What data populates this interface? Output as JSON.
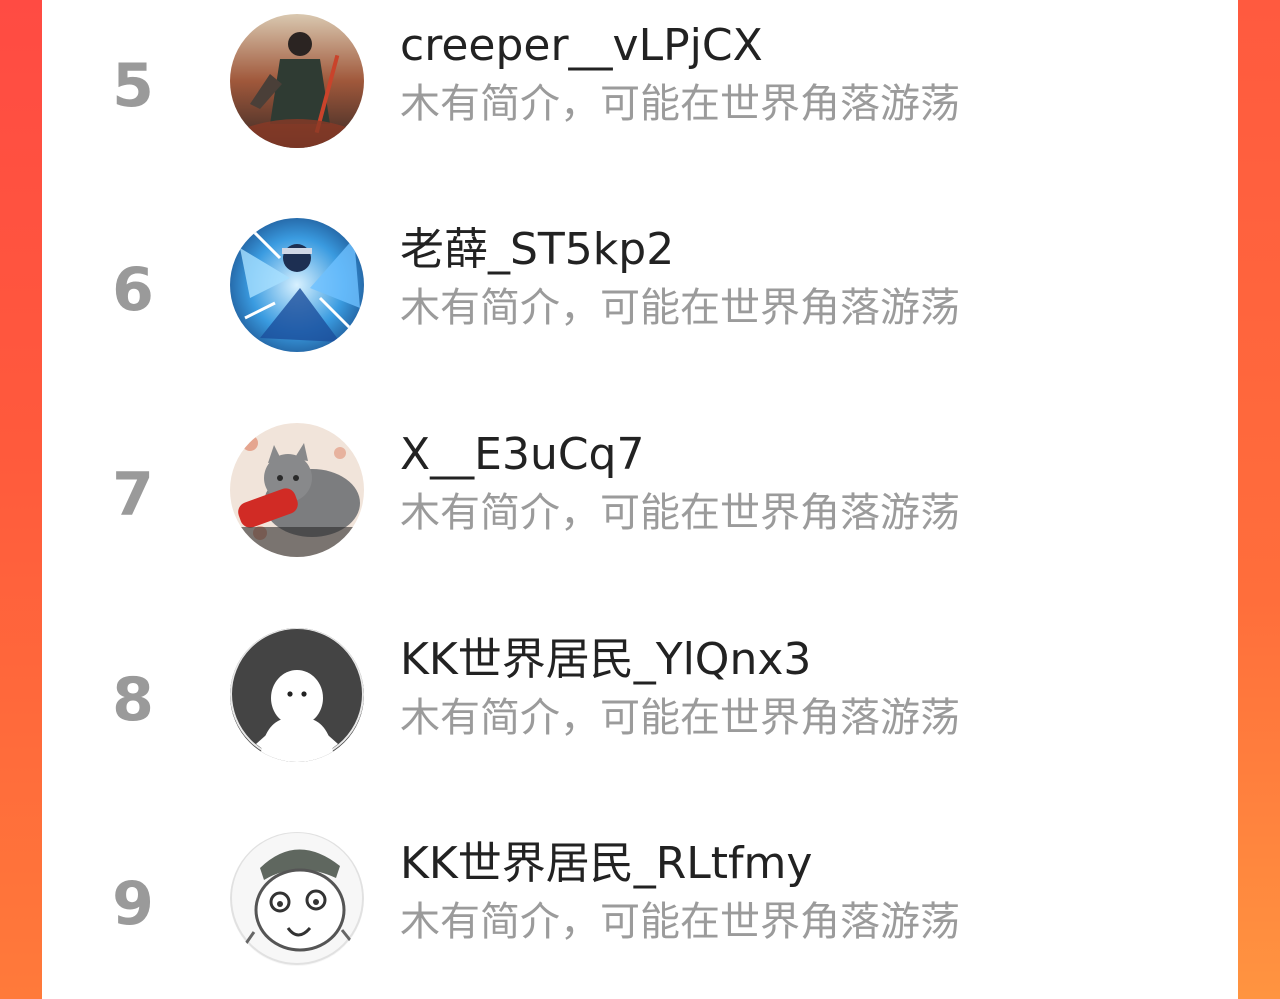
{
  "ranking": {
    "items": [
      {
        "rank": "5",
        "username": "creeper__vLPjCX",
        "bio": "木有简介，可能在世界角落游荡",
        "avatar": "warrior-avatar-icon"
      },
      {
        "rank": "6",
        "username": "老薛_ST5kp2",
        "bio": "木有简介，可能在世界角落游荡",
        "avatar": "ninja-avatar-icon"
      },
      {
        "rank": "7",
        "username": "X__E3uCq7",
        "bio": "木有简介，可能在世界角落游荡",
        "avatar": "cat-avatar-icon"
      },
      {
        "rank": "8",
        "username": "KK世界居民_YlQnx3",
        "bio": "木有简介，可能在世界角落游荡",
        "avatar": "default-avatar-icon"
      },
      {
        "rank": "9",
        "username": "KK世界居民_RLtfmy",
        "bio": "木有简介，可能在世界角落游荡",
        "avatar": "meme-avatar-icon"
      }
    ]
  },
  "colors": {
    "background": "#ff4b43",
    "panel": "#ffffff",
    "rank_text": "#9a9a9a",
    "name_text": "#222222",
    "bio_text": "#9b9b9b"
  }
}
